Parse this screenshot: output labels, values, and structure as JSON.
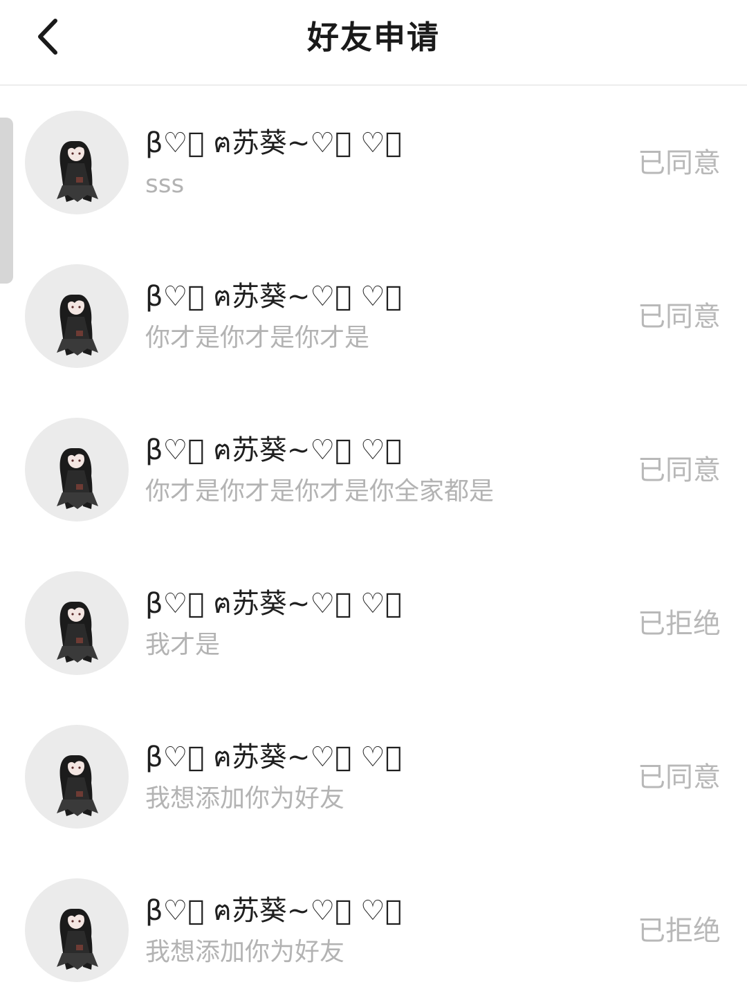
{
  "header": {
    "title": "好友申请"
  },
  "requests": [
    {
      "name": "β♡ᷝ ฅ苏葵~♡ᷝ ♡ᷝ",
      "message": "sss",
      "status": "已同意"
    },
    {
      "name": "β♡ᷝ ฅ苏葵~♡ᷝ ♡ᷝ",
      "message": "你才是你才是你才是",
      "status": "已同意"
    },
    {
      "name": "β♡ᷝ ฅ苏葵~♡ᷝ ♡ᷝ",
      "message": "你才是你才是你才是你全家都是",
      "status": "已同意"
    },
    {
      "name": "β♡ᷝ ฅ苏葵~♡ᷝ ♡ᷝ",
      "message": "我才是",
      "status": "已拒绝"
    },
    {
      "name": "β♡ᷝ ฅ苏葵~♡ᷝ ♡ᷝ",
      "message": "我想添加你为好友",
      "status": "已同意"
    },
    {
      "name": "β♡ᷝ ฅ苏葵~♡ᷝ ♡ᷝ",
      "message": "我想添加你为好友",
      "status": "已拒绝"
    }
  ]
}
